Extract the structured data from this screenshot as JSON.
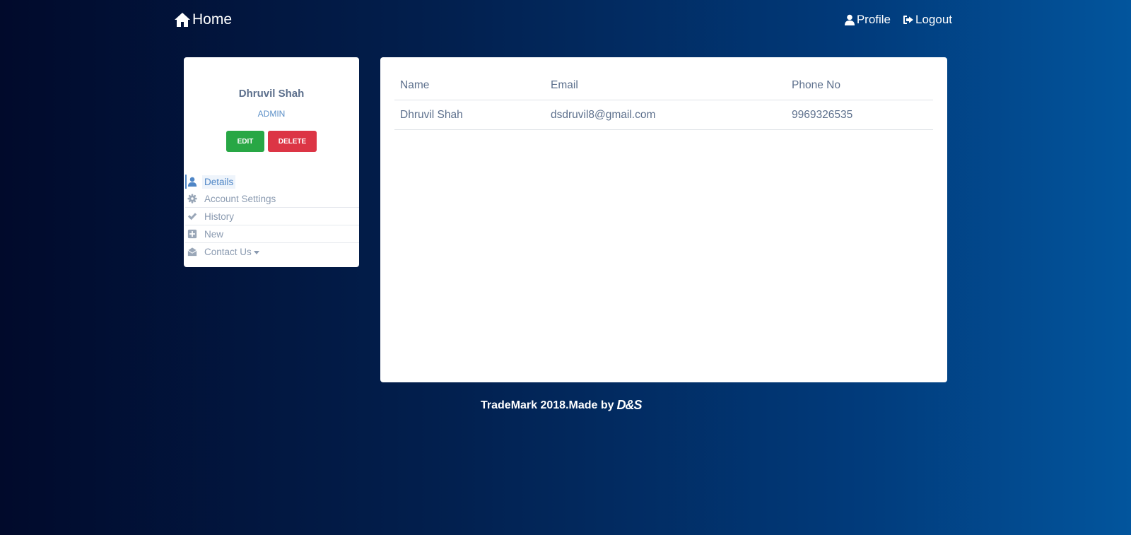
{
  "nav": {
    "home_label": "Home",
    "profile_label": "Profile",
    "logout_label": "Logout"
  },
  "profile": {
    "name": "Dhruvil Shah",
    "role": "ADMIN",
    "edit_label": "EDIT",
    "delete_label": "DELETE"
  },
  "menu": {
    "items": [
      {
        "label": "Details",
        "icon": "user-icon",
        "active": true
      },
      {
        "label": "Account Settings",
        "icon": "gear-icon"
      },
      {
        "label": "History",
        "icon": "check-icon"
      },
      {
        "label": "New",
        "icon": "plus-square-icon"
      },
      {
        "label": "Contact Us",
        "icon": "envelope-open-icon",
        "dropdown": true
      }
    ]
  },
  "table": {
    "headers": [
      "Name",
      "Email",
      "Phone No"
    ],
    "rows": [
      [
        "Dhruvil Shah",
        "dsdruvil8@gmail.com",
        "9969326535"
      ]
    ]
  },
  "footer": {
    "text": "TradeMark 2018.Made by",
    "brand": "D&S"
  },
  "colors": {
    "accent": "#4f86c6",
    "edit": "#28a745",
    "delete": "#dc3545"
  }
}
